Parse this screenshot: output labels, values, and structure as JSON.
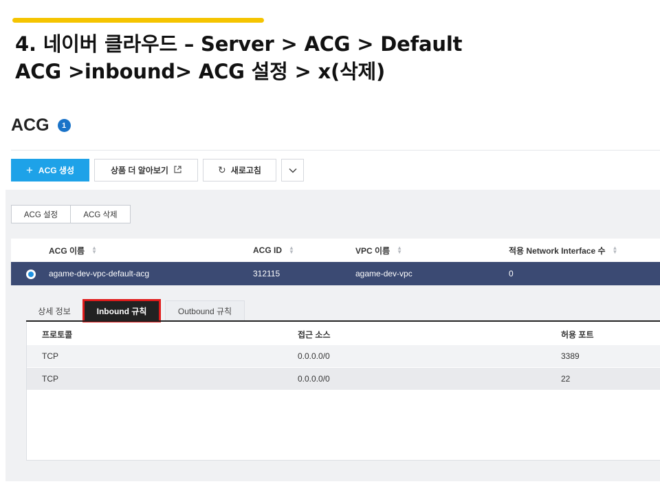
{
  "slide": {
    "title_line1": "4. 네이버 클라우드 – Server > ACG > Default",
    "title_line2": "ACG >inbound> ACG 설정 > x(삭제)",
    "accent_color": "#f5c400"
  },
  "page": {
    "title": "ACG",
    "count": "1"
  },
  "toolbar": {
    "create_label": "ACG 생성",
    "create_icon": "plus-icon",
    "learn_more_label": "상품 더 알아보기",
    "learn_more_icon": "external-link-icon",
    "refresh_label": "새로고침",
    "refresh_icon": "refresh-icon",
    "more_icon": "chevron-down-icon"
  },
  "actions": {
    "settings_label": "ACG 설정",
    "delete_label": "ACG 삭제"
  },
  "acg_table": {
    "columns": [
      "ACG 이름",
      "ACG ID",
      "VPC 이름",
      "적용 Network Interface 수"
    ],
    "rows": [
      {
        "name": "agame-dev-vpc-default-acg",
        "id": "312115",
        "vpc": "agame-dev-vpc",
        "interfaces": "0",
        "selected": true
      }
    ],
    "selected_row_color": "#3b4a73"
  },
  "detail_tabs": {
    "tabs": [
      "상세 정보",
      "Inbound 규칙",
      "Outbound 규칙"
    ],
    "active": "Inbound 규칙",
    "highlight_color": "#e01b1b"
  },
  "inbound_rules": {
    "columns": [
      "프로토콜",
      "접근 소스",
      "허용 포트"
    ],
    "rows": [
      {
        "protocol": "TCP",
        "source": "0.0.0.0/0",
        "port": "3389"
      },
      {
        "protocol": "TCP",
        "source": "0.0.0.0/0",
        "port": "22"
      }
    ]
  }
}
